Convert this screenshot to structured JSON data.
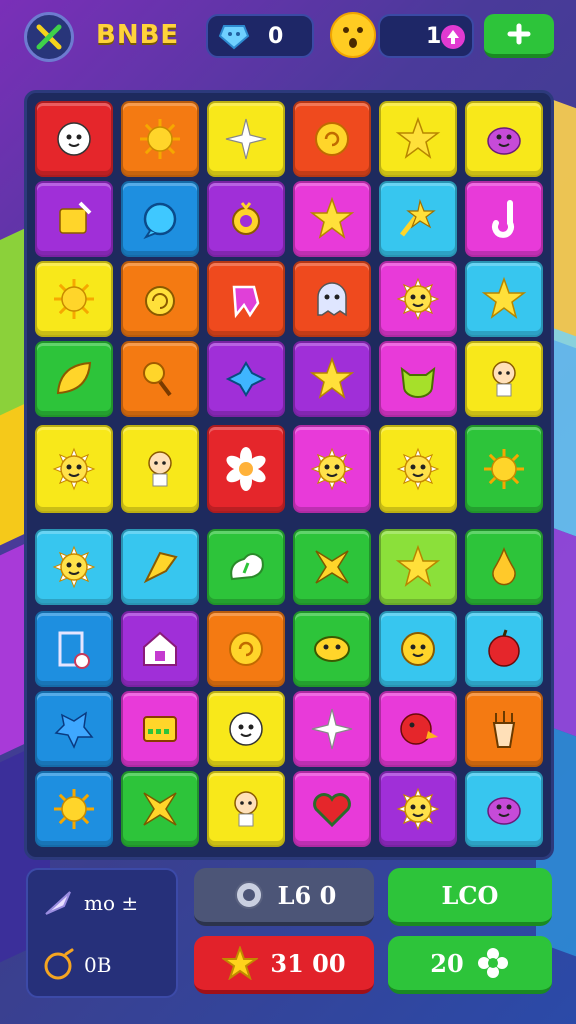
{
  "header": {
    "title": "BNBE",
    "gems_value": "0",
    "level_value": "1"
  },
  "colors": {
    "red": "#e5262b",
    "orange": "#f47a12",
    "yellow": "#f8e81a",
    "purple": "#a02fd8",
    "magenta": "#e83ad9",
    "blue": "#1e8fe0",
    "cyan": "#37c6ef",
    "green": "#2dc43a",
    "lime": "#8be03a",
    "orange_red": "#ef4a1e"
  },
  "board": {
    "rows": [
      [
        "red:face-icon",
        "orange:sun-icon",
        "yellow:sparkle-icon",
        "orange_red:swirl-icon",
        "yellow:star-icon",
        "yellow:blob-icon"
      ],
      [
        "purple:bag-icon",
        "blue:bubble-icon",
        "purple:ring-icon",
        "magenta:star-icon",
        "cyan:star-wand-icon",
        "magenta:hook-icon"
      ],
      [
        "yellow:sun-icon",
        "orange:snail-icon",
        "orange_red:mitten-icon",
        "orange_red:ghost-icon",
        "magenta:sun-face-icon",
        "cyan:star-icon"
      ],
      [
        "green:leaf-icon",
        "orange:wand-icon",
        "purple:cross-star-icon",
        "purple:star-icon",
        "magenta:cat-icon",
        "yellow:doll-icon"
      ],
      [
        "yellow:sun-face-icon",
        "yellow:doll-icon",
        "red:flower-icon",
        "magenta:sun-face-icon",
        "yellow:sun-face-icon",
        "green:sun-icon"
      ],
      [
        "cyan:sun-face-icon",
        "cyan:flag-icon",
        "green:cloud-icon",
        "green:x-star-icon",
        "lime:star-icon",
        "green:pear-icon"
      ],
      [
        "blue:door-icon",
        "purple:house-icon",
        "orange:swirl-icon",
        "green:fish-icon",
        "cyan:smile-icon",
        "cyan:apple-icon"
      ],
      [
        "blue:splat-icon",
        "magenta:box-icon",
        "yellow:face-icon",
        "magenta:sparkle-icon",
        "magenta:bird-icon",
        "orange:cup-icon"
      ],
      [
        "blue:sun-icon",
        "green:x-star-icon",
        "yellow:doll-icon",
        "magenta:heart-icon",
        "purple:sun-face-icon",
        "cyan:blob-icon"
      ]
    ]
  },
  "footer": {
    "info_line1": "mo ±",
    "info_line2": "0B",
    "gray_button": "L6 0",
    "red_button": "31 00",
    "green_button_top": "LCO",
    "green_button_bottom": "20"
  }
}
